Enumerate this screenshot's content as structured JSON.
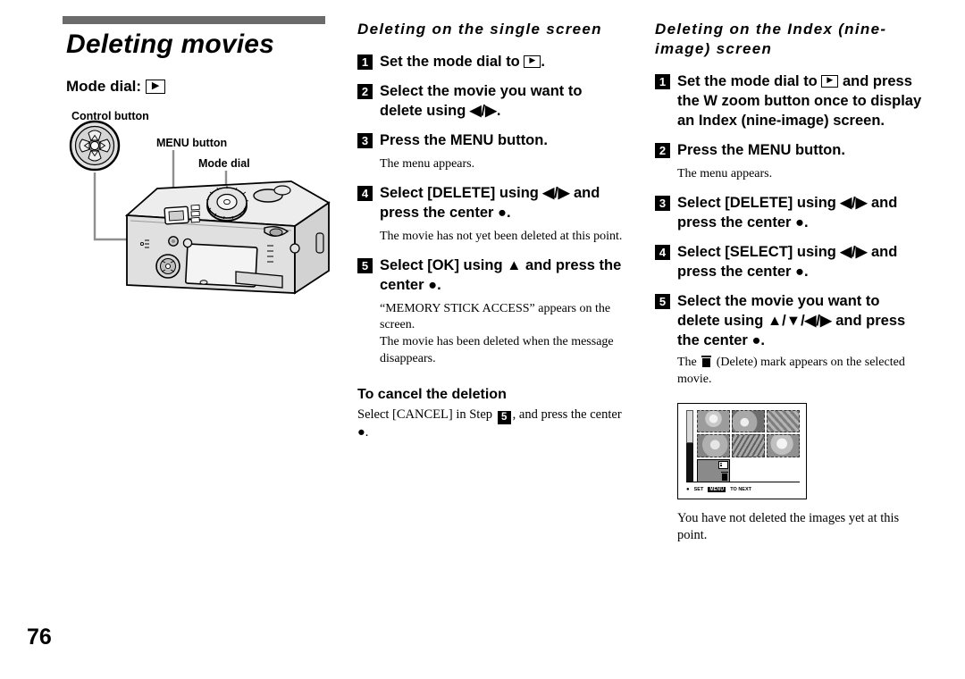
{
  "page": {
    "number": "76"
  },
  "left": {
    "chapter_title": "Deleting movies",
    "mode_dial_label": "Mode dial:",
    "mode_dial_glyph": "play-icon",
    "figure": {
      "labels": {
        "control_button": "Control button",
        "menu_button": "MENU button",
        "mode_dial": "Mode dial"
      },
      "name": "camera-rear-diagram"
    }
  },
  "middle": {
    "heading": "Deleting on the single screen",
    "steps": [
      {
        "num": "1",
        "text_before": "Set the mode dial to ",
        "glyph": "play-icon",
        "text_after": ".",
        "note": ""
      },
      {
        "num": "2",
        "text": "Select the movie you want to delete using ◀/▶.",
        "note": ""
      },
      {
        "num": "3",
        "text": "Press the MENU button.",
        "note": "The menu appears."
      },
      {
        "num": "4",
        "text": "Select [DELETE] using ◀/▶ and press the center ●.",
        "note": "The movie has not yet been deleted at this point."
      },
      {
        "num": "5",
        "text": "Select [OK] using ▲ and press the center  ●.",
        "note": "“MEMORY STICK ACCESS” appears on the screen.\nThe movie has been deleted when the message disappears."
      }
    ],
    "cancel": {
      "subhead": "To cancel the deletion",
      "text_before": "Select [CANCEL] in Step ",
      "step_ref": "5",
      "text_after": ", and press the center ●."
    }
  },
  "right": {
    "heading": "Deleting on the Index (nine-image) screen",
    "steps": [
      {
        "num": "1",
        "text_before": "Set the mode dial to ",
        "glyph": "play-icon",
        "text_after": " and press the W zoom button once to display an Index (nine-image) screen.",
        "note": ""
      },
      {
        "num": "2",
        "text": "Press the MENU button.",
        "note": "The menu appears."
      },
      {
        "num": "3",
        "text": "Select [DELETE] using ◀/▶ and press the center ●.",
        "note": ""
      },
      {
        "num": "4",
        "text": "Select [SELECT] using ◀/▶ and press the center ●.",
        "note": ""
      },
      {
        "num": "5",
        "text": "Select the movie you want to delete using ▲/▼/◀/▶ and press the center ●.",
        "note_before": "The ",
        "note_glyph": "trash-icon",
        "note_after": " (Delete) mark appears on the selected movie."
      }
    ],
    "lcd": {
      "name": "index-nine-image-screen",
      "set_label": "SET",
      "menu_chip": "MENU",
      "to_next_label": "TO NEXT",
      "selected_overlay_icons": [
        "movie-icon",
        "trash-icon"
      ]
    },
    "footnote": "You have not deleted the images yet at this point."
  },
  "colors": {
    "rule": "#6b6b6b",
    "text": "#000000",
    "badge_bg": "#000000",
    "badge_fg": "#ffffff"
  }
}
